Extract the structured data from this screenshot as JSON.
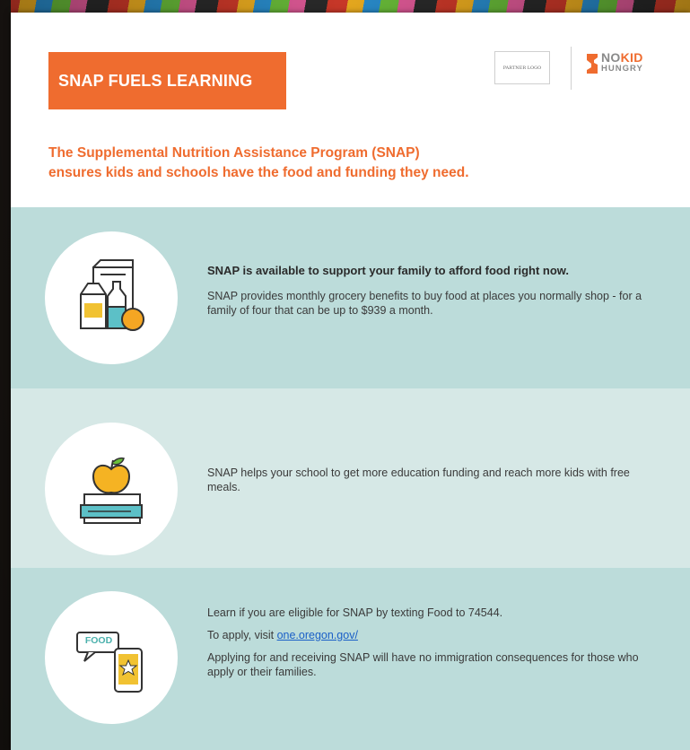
{
  "header": {
    "title": "SNAP FUELS LEARNING",
    "partner_logo_text": "PARTNER LOGO",
    "nkh_logo_no": "NO",
    "nkh_logo_kid": "KID",
    "nkh_logo_hungry": "HUNGRY",
    "intro_line1": "The Supplemental Nutrition Assistance Program (SNAP)",
    "intro_line2": "ensures kids and schools have the food and funding they need."
  },
  "sections": [
    {
      "icon": "groceries-icon",
      "lead": "SNAP is available to support your family to afford food right now.",
      "body": "SNAP provides monthly grocery benefits to buy food at places you normally shop - for a family of four that can be up to $939 a month."
    },
    {
      "icon": "apple-books-icon",
      "body": "SNAP helps your school to get more education funding and reach more kids with free meals."
    },
    {
      "icon": "food-text-phone-icon",
      "icon_label": "FOOD",
      "line1": "Learn if you are eligible for SNAP by texting Food to 74544.",
      "line2_prefix": "To apply, visit ",
      "line2_link": "one.oregon.gov/",
      "line3": "Applying for and receiving SNAP will have no immigration consequences for those who apply or their families."
    }
  ],
  "colors": {
    "orange": "#ef6c2f",
    "teal_band": "#bcdcda",
    "light_teal_band": "#d6e8e6"
  }
}
